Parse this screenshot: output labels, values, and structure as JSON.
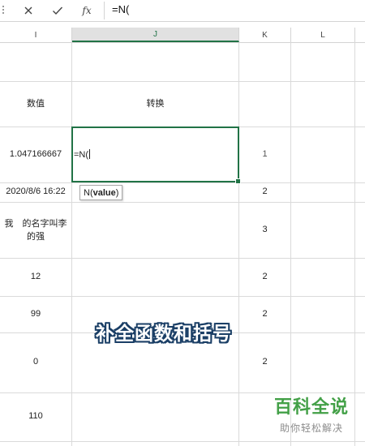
{
  "formula_bar": {
    "cancel_icon": "close-icon",
    "confirm_icon": "check-icon",
    "fx_label": "fx",
    "formula": "=N("
  },
  "columns": [
    "I",
    "J",
    "K",
    "L"
  ],
  "cells": {
    "i_header": "数值",
    "j_header": "转换",
    "i_row1": "1.047166667",
    "j_row1_edit": "=N(",
    "k_row1": "1",
    "i_row2": "2020/8/6 16:22",
    "k_row2": "2",
    "i_row3": "我　的名字叫李的强",
    "k_row3": "3",
    "i_row4": "12",
    "k_row4": "2",
    "i_row5": "99",
    "k_row5": "2",
    "i_row6": "0",
    "k_row6": "2",
    "i_row7": "110"
  },
  "tooltip": {
    "func": "N(",
    "arg": "value",
    "close": ")"
  },
  "overlay_caption": "补全函数和括号",
  "watermark": {
    "brand": "百科全说",
    "slogan": "助你轻松解决"
  },
  "colors": {
    "accent": "#217346",
    "watermark_green": "#43a047"
  }
}
